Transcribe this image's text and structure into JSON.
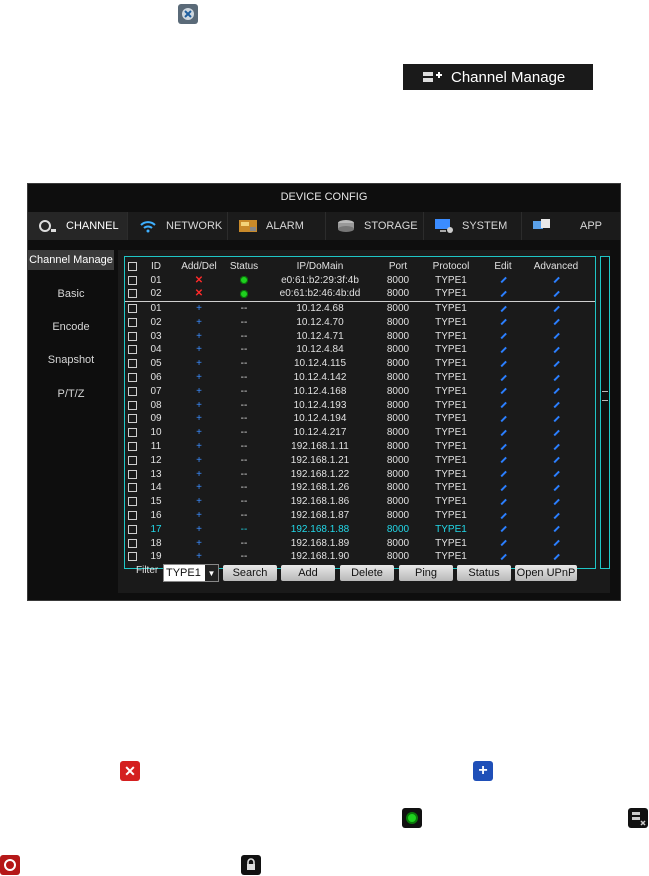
{
  "doc": {
    "channel_manage_label": "Channel Manage"
  },
  "window": {
    "title": "DEVICE CONFIG",
    "tabs": [
      {
        "label": "CHANNEL"
      },
      {
        "label": "NETWORK"
      },
      {
        "label": "ALARM"
      },
      {
        "label": "STORAGE"
      },
      {
        "label": "SYSTEM"
      },
      {
        "label": "APP"
      }
    ],
    "sidebar": [
      {
        "label": "Channel Manage"
      },
      {
        "label": "Basic"
      },
      {
        "label": "Encode"
      },
      {
        "label": "Snapshot"
      },
      {
        "label": "P/T/Z"
      }
    ],
    "table": {
      "headers": [
        "ID",
        "Add/Del",
        "Status",
        "IP/DoMain",
        "Port",
        "Protocol",
        "Edit",
        "Advanced"
      ],
      "added": [
        {
          "id": "01",
          "ip": "e0:61:b2:29:3f:4b",
          "port": "8000",
          "protocol": "TYPE1"
        },
        {
          "id": "02",
          "ip": "e0:61:b2:46:4b:dd",
          "port": "8000",
          "protocol": "TYPE1"
        }
      ],
      "found": [
        {
          "id": "01",
          "status": "--",
          "ip": "10.12.4.68",
          "port": "8000",
          "protocol": "TYPE1"
        },
        {
          "id": "02",
          "status": "--",
          "ip": "10.12.4.70",
          "port": "8000",
          "protocol": "TYPE1"
        },
        {
          "id": "03",
          "status": "--",
          "ip": "10.12.4.71",
          "port": "8000",
          "protocol": "TYPE1"
        },
        {
          "id": "04",
          "status": "--",
          "ip": "10.12.4.84",
          "port": "8000",
          "protocol": "TYPE1"
        },
        {
          "id": "05",
          "status": "--",
          "ip": "10.12.4.115",
          "port": "8000",
          "protocol": "TYPE1"
        },
        {
          "id": "06",
          "status": "--",
          "ip": "10.12.4.142",
          "port": "8000",
          "protocol": "TYPE1"
        },
        {
          "id": "07",
          "status": "--",
          "ip": "10.12.4.168",
          "port": "8000",
          "protocol": "TYPE1"
        },
        {
          "id": "08",
          "status": "--",
          "ip": "10.12.4.193",
          "port": "8000",
          "protocol": "TYPE1"
        },
        {
          "id": "09",
          "status": "--",
          "ip": "10.12.4.194",
          "port": "8000",
          "protocol": "TYPE1"
        },
        {
          "id": "10",
          "status": "--",
          "ip": "10.12.4.217",
          "port": "8000",
          "protocol": "TYPE1"
        },
        {
          "id": "11",
          "status": "--",
          "ip": "192.168.1.11",
          "port": "8000",
          "protocol": "TYPE1"
        },
        {
          "id": "12",
          "status": "--",
          "ip": "192.168.1.21",
          "port": "8000",
          "protocol": "TYPE1"
        },
        {
          "id": "13",
          "status": "--",
          "ip": "192.168.1.22",
          "port": "8000",
          "protocol": "TYPE1"
        },
        {
          "id": "14",
          "status": "--",
          "ip": "192.168.1.26",
          "port": "8000",
          "protocol": "TYPE1"
        },
        {
          "id": "15",
          "status": "--",
          "ip": "192.168.1.86",
          "port": "8000",
          "protocol": "TYPE1"
        },
        {
          "id": "16",
          "status": "--",
          "ip": "192.168.1.87",
          "port": "8000",
          "protocol": "TYPE1"
        },
        {
          "id": "17",
          "status": "--",
          "ip": "192.168.1.88",
          "port": "8000",
          "protocol": "TYPE1",
          "highlighted": true
        },
        {
          "id": "18",
          "status": "--",
          "ip": "192.168.1.89",
          "port": "8000",
          "protocol": "TYPE1"
        },
        {
          "id": "19",
          "status": "--",
          "ip": "192.168.1.90",
          "port": "8000",
          "protocol": "TYPE1"
        }
      ]
    },
    "filter": {
      "label": "Filter",
      "value": "TYPE1"
    },
    "buttons": {
      "search": "Search",
      "add": "Add",
      "delete": "Delete",
      "ping": "Ping",
      "status": "Status",
      "upnp": "Open UPnP"
    }
  },
  "colors": {
    "accent_cyan": "#1fc6c6",
    "highlight_row": "#22d8e8",
    "delete_red": "#ff2a2a",
    "add_blue": "#3b8cff",
    "status_green": "#1fd11f"
  }
}
